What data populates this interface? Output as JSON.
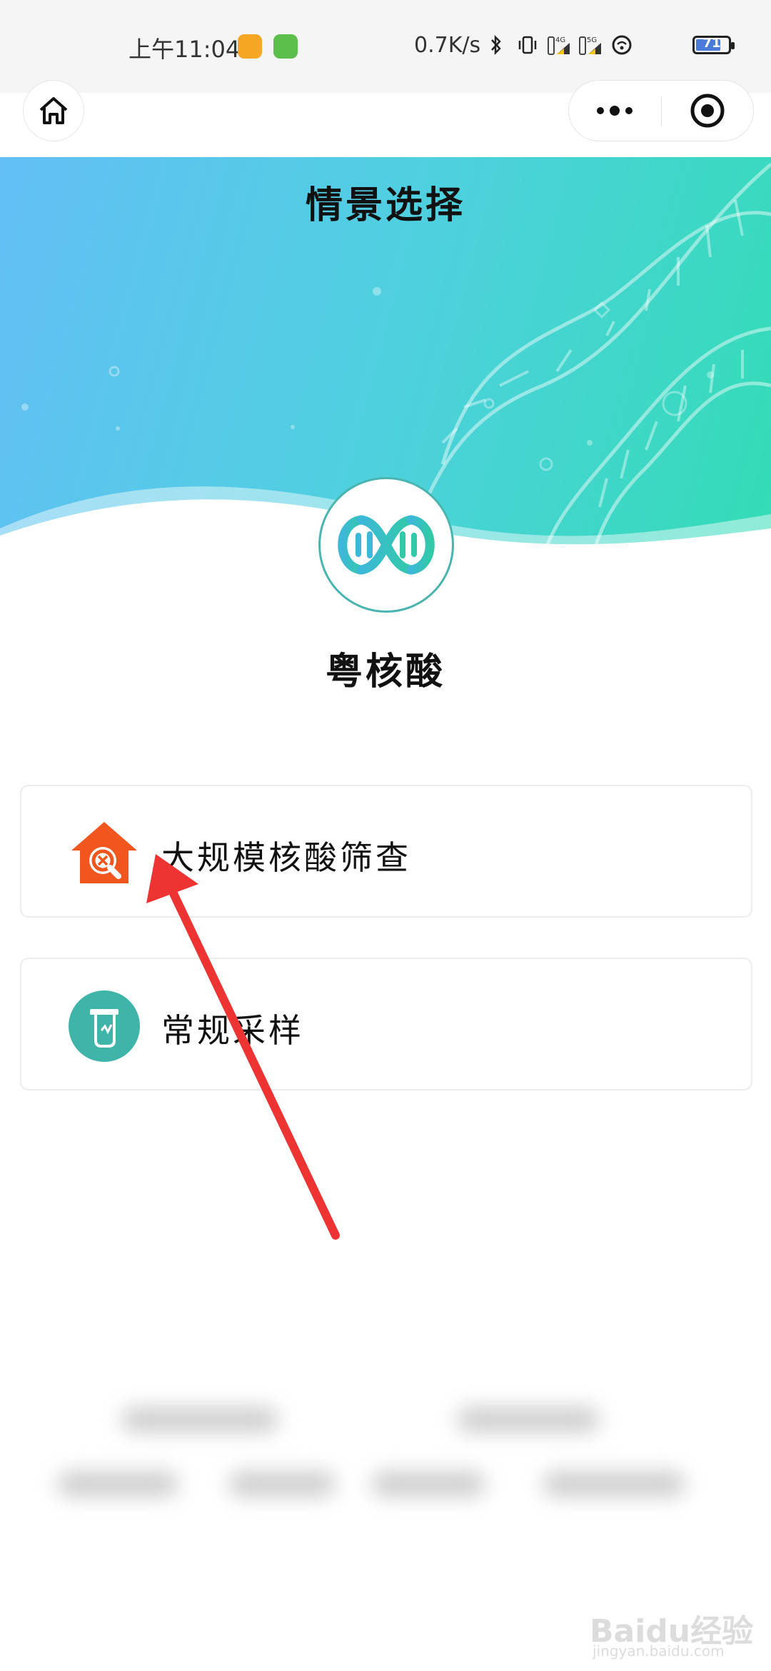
{
  "status_bar": {
    "time": "上午11:04",
    "network_speed": "0.7K/s",
    "battery_level": "71",
    "network_labels": [
      "4G",
      "5G"
    ]
  },
  "nav": {
    "home_icon": "home-icon",
    "more_icon": "more-dots-icon",
    "close_icon": "target-close-icon"
  },
  "header": {
    "title": "情景选择"
  },
  "app": {
    "name": "粤核酸",
    "logo_icon": "dna-logo-icon"
  },
  "options": [
    {
      "label": "大规模核酸筛查",
      "icon": "house-search-icon",
      "icon_color": "#f0561d"
    },
    {
      "label": "常规采样",
      "icon": "test-tube-icon",
      "icon_color": "#3fb5aa"
    }
  ],
  "colors": {
    "banner_start": "#63bff5",
    "banner_end": "#33dcb6",
    "accent_teal": "#3fb5aa",
    "annotation_red": "#ee3333"
  },
  "watermark": {
    "text": "Baidu经验",
    "sub": "jingyan.baidu.com"
  }
}
